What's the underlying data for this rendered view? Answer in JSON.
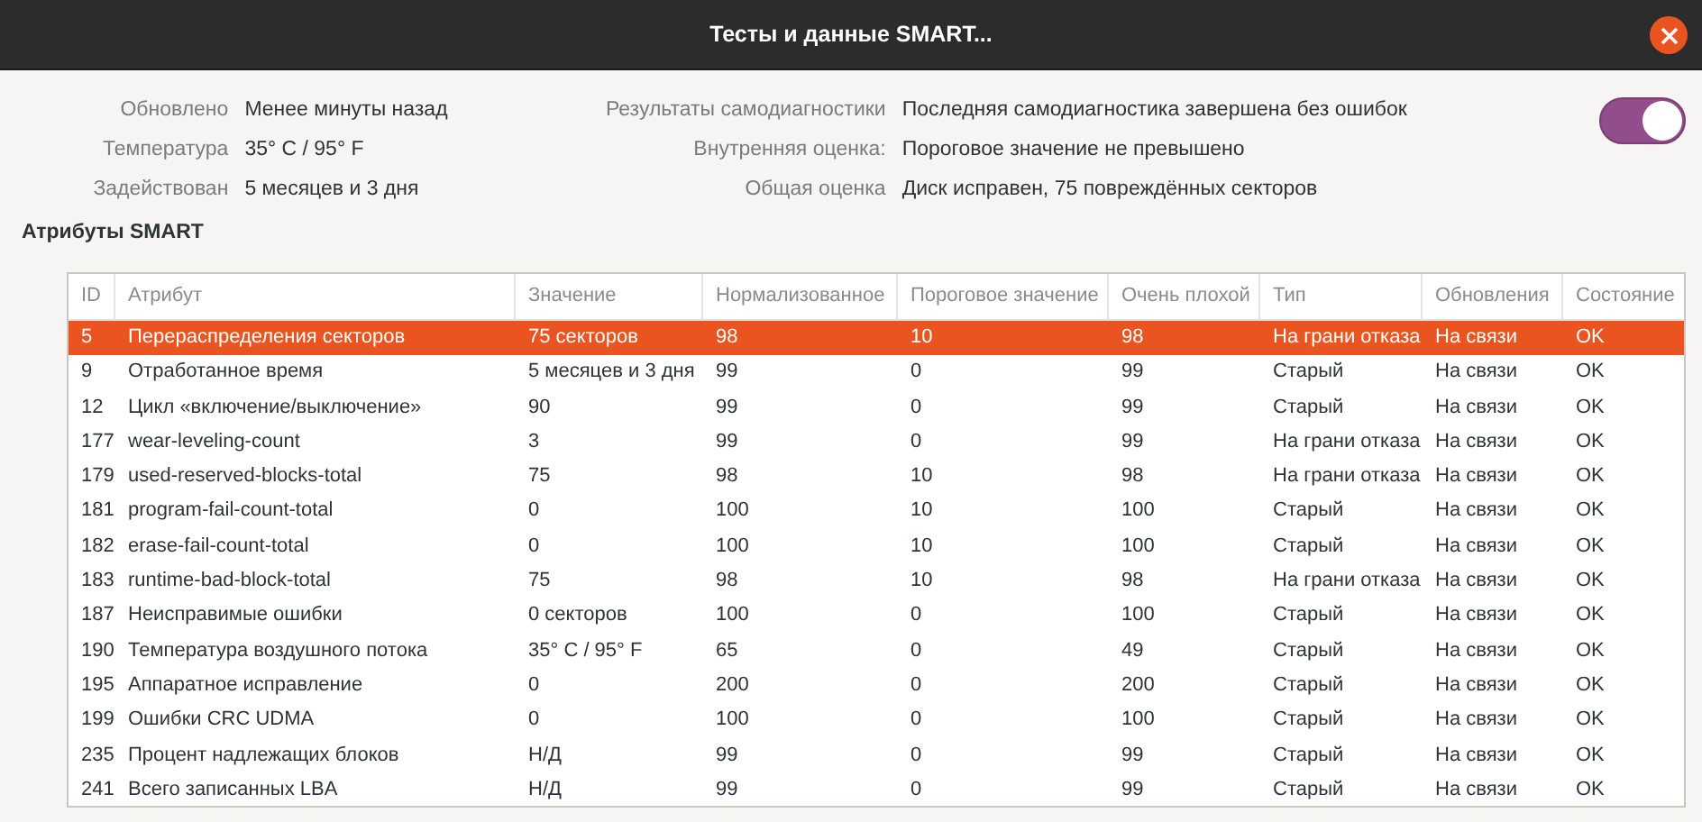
{
  "window": {
    "title": "Тесты и данные SMART..."
  },
  "info_left": [
    {
      "label": "Обновлено",
      "value": "Менее минуты назад"
    },
    {
      "label": "Температура",
      "value": "35° C / 95° F"
    },
    {
      "label": "Задействован",
      "value": "5 месяцев и 3 дня"
    }
  ],
  "info_right": [
    {
      "label": "Результаты самодиагностики",
      "value": "Последняя самодиагностика завершена без ошибок"
    },
    {
      "label": "Внутренняя оценка:",
      "value": "Пороговое значение не превышено"
    },
    {
      "label": "Общая оценка",
      "value": "Диск исправен, 75 повреждённых секторов"
    }
  ],
  "toggle": {
    "on": true
  },
  "section_title": "Атрибуты SMART",
  "table": {
    "columns": [
      "ID",
      "Атрибут",
      "Значение",
      "Нормализованное",
      "Пороговое значение",
      "Очень плохой",
      "Тип",
      "Обновления",
      "Состояние"
    ],
    "rows": [
      {
        "selected": true,
        "cells": [
          "5",
          "Перераспределения секторов",
          "75 секторов",
          "98",
          "10",
          "98",
          "На грани отказа",
          "На связи",
          "OK"
        ]
      },
      {
        "selected": false,
        "cells": [
          "9",
          "Отработанное время",
          "5 месяцев и 3 дня",
          "99",
          "0",
          "99",
          "Старый",
          "На связи",
          "OK"
        ]
      },
      {
        "selected": false,
        "cells": [
          "12",
          "Цикл «включение/выключение»",
          "90",
          "99",
          "0",
          "99",
          "Старый",
          "На связи",
          "OK"
        ]
      },
      {
        "selected": false,
        "cells": [
          "177",
          "wear-leveling-count",
          "3",
          "99",
          "0",
          "99",
          "На грани отказа",
          "На связи",
          "OK"
        ]
      },
      {
        "selected": false,
        "cells": [
          "179",
          "used-reserved-blocks-total",
          "75",
          "98",
          "10",
          "98",
          "На грани отказа",
          "На связи",
          "OK"
        ]
      },
      {
        "selected": false,
        "cells": [
          "181",
          "program-fail-count-total",
          "0",
          "100",
          "10",
          "100",
          "Старый",
          "На связи",
          "OK"
        ]
      },
      {
        "selected": false,
        "cells": [
          "182",
          "erase-fail-count-total",
          "0",
          "100",
          "10",
          "100",
          "Старый",
          "На связи",
          "OK"
        ]
      },
      {
        "selected": false,
        "cells": [
          "183",
          "runtime-bad-block-total",
          "75",
          "98",
          "10",
          "98",
          "На грани отказа",
          "На связи",
          "OK"
        ]
      },
      {
        "selected": false,
        "cells": [
          "187",
          "Неисправимые ошибки",
          "0 секторов",
          "100",
          "0",
          "100",
          "Старый",
          "На связи",
          "OK"
        ]
      },
      {
        "selected": false,
        "cells": [
          "190",
          "Температура воздушного потока",
          "35° C / 95° F",
          "65",
          "0",
          "49",
          "Старый",
          "На связи",
          "OK"
        ]
      },
      {
        "selected": false,
        "cells": [
          "195",
          "Аппаратное исправление",
          "0",
          "200",
          "0",
          "200",
          "Старый",
          "На связи",
          "OK"
        ]
      },
      {
        "selected": false,
        "cells": [
          "199",
          "Ошибки CRC UDMA",
          "0",
          "100",
          "0",
          "100",
          "Старый",
          "На связи",
          "OK"
        ]
      },
      {
        "selected": false,
        "cells": [
          "235",
          "Процент надлежащих блоков",
          "Н/Д",
          "99",
          "0",
          "99",
          "Старый",
          "На связи",
          "OK"
        ]
      },
      {
        "selected": false,
        "cells": [
          "241",
          "Всего записанных LBA",
          "Н/Д",
          "99",
          "0",
          "99",
          "Старый",
          "На связи",
          "OK"
        ]
      }
    ]
  }
}
